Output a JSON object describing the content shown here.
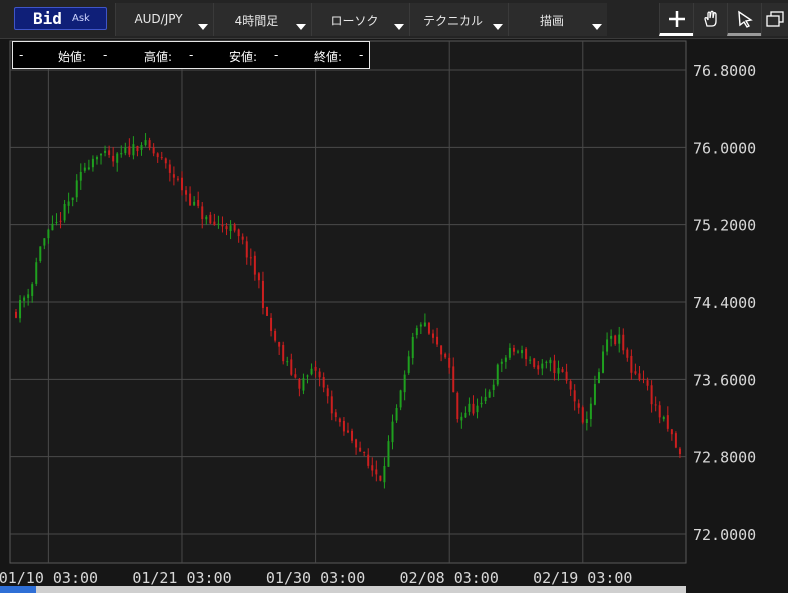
{
  "toolbar": {
    "bid_label": "Bid",
    "ask_label": "Ask",
    "pair": "AUD/JPY",
    "timeframe": "4時間足",
    "chart_style": "ローソク",
    "technical": "テクニカル",
    "drawing": "描画",
    "tools": [
      "crosshair-icon",
      "hand-icon",
      "cursor-icon",
      "window-icon"
    ]
  },
  "ohlc_panel": {
    "date": "-",
    "open_label": "始値:",
    "open": "-",
    "high_label": "高値:",
    "high": "-",
    "low_label": "安値:",
    "low": "-",
    "close_label": "終値:",
    "close": "-"
  },
  "colors": {
    "up": "#1fa01f",
    "down": "#cc1f1f",
    "grid": "#4a4a4a",
    "background": "#161616",
    "text": "#d8d8d8"
  },
  "chart_data": {
    "type": "candlestick",
    "ylim": [
      71.7,
      77.1
    ],
    "yticks": [
      "72.0000",
      "72.8000",
      "73.6000",
      "74.4000",
      "75.2000",
      "76.0000",
      "76.8000"
    ],
    "xticks": [
      {
        "label": "01/10 03:00",
        "index": 8
      },
      {
        "label": "01/21 03:00",
        "index": 41
      },
      {
        "label": "01/30 03:00",
        "index": 74
      },
      {
        "label": "02/08 03:00",
        "index": 107
      },
      {
        "label": "02/19 03:00",
        "index": 140
      }
    ],
    "n_candles": 165,
    "close_path": [
      [
        0,
        74.3
      ],
      [
        4,
        74.6
      ],
      [
        6,
        75.0
      ],
      [
        10,
        75.2
      ],
      [
        14,
        75.5
      ],
      [
        17,
        75.8
      ],
      [
        20,
        75.95
      ],
      [
        24,
        75.85
      ],
      [
        27,
        75.95
      ],
      [
        31,
        76.05
      ],
      [
        35,
        75.9
      ],
      [
        39,
        75.7
      ],
      [
        44,
        75.4
      ],
      [
        48,
        75.2
      ],
      [
        52,
        75.2
      ],
      [
        56,
        75.0
      ],
      [
        60,
        74.6
      ],
      [
        62,
        74.2
      ],
      [
        64,
        74.0
      ],
      [
        66,
        73.8
      ],
      [
        70,
        73.55
      ],
      [
        74,
        73.7
      ],
      [
        77,
        73.4
      ],
      [
        80,
        73.1
      ],
      [
        84,
        72.95
      ],
      [
        87,
        72.7
      ],
      [
        90,
        72.6
      ],
      [
        93,
        73.1
      ],
      [
        96,
        73.6
      ],
      [
        98,
        74.0
      ],
      [
        100,
        74.2
      ],
      [
        103,
        74.0
      ],
      [
        107,
        73.7
      ],
      [
        109,
        73.2
      ],
      [
        112,
        73.3
      ],
      [
        115,
        73.3
      ],
      [
        118,
        73.6
      ],
      [
        120,
        73.8
      ],
      [
        123,
        73.9
      ],
      [
        126,
        73.85
      ],
      [
        129,
        73.7
      ],
      [
        132,
        73.75
      ],
      [
        135,
        73.65
      ],
      [
        138,
        73.4
      ],
      [
        140,
        73.1
      ],
      [
        143,
        73.5
      ],
      [
        146,
        74.0
      ],
      [
        149,
        74.0
      ],
      [
        152,
        73.7
      ],
      [
        155,
        73.6
      ],
      [
        158,
        73.3
      ],
      [
        162,
        73.0
      ],
      [
        164,
        72.8
      ]
    ],
    "volatility": 0.08,
    "seed": 11
  }
}
